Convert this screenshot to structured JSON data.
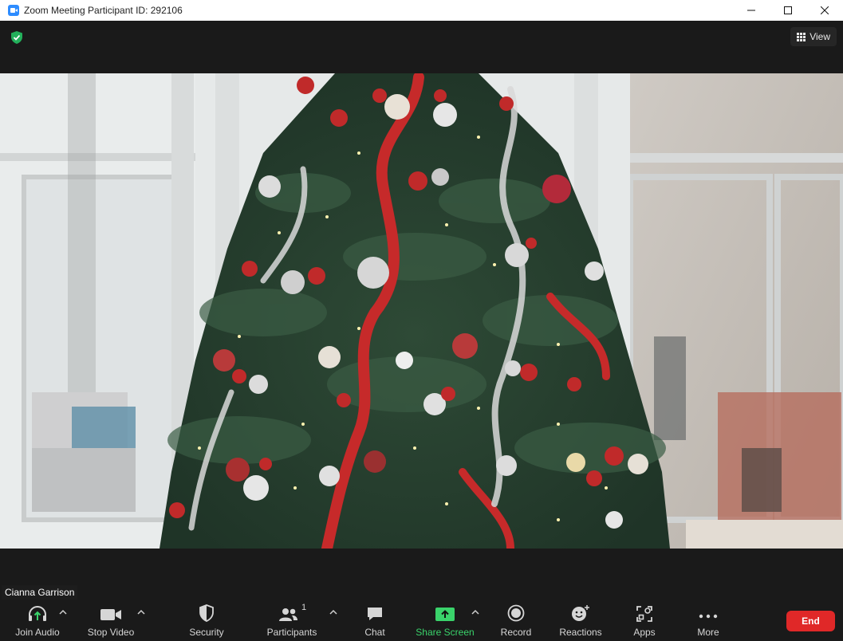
{
  "window": {
    "title": "Zoom Meeting Participant ID: 292106",
    "icon": "zoom-camera-icon"
  },
  "topbar": {
    "security_icon": "green-shield-check-icon",
    "view_label": "View"
  },
  "video": {
    "participant_name": "Cianna Garrison"
  },
  "toolbar": {
    "join_audio": "Join Audio",
    "stop_video": "Stop Video",
    "security": "Security",
    "participants": "Participants",
    "participants_count": "1",
    "chat": "Chat",
    "share_screen": "Share Screen",
    "record": "Record",
    "reactions": "Reactions",
    "apps": "Apps",
    "more": "More",
    "end": "End"
  },
  "colors": {
    "accent_green": "#3ad36b",
    "end_red": "#e02828",
    "toolbar_bg": "#1a1a1a"
  }
}
